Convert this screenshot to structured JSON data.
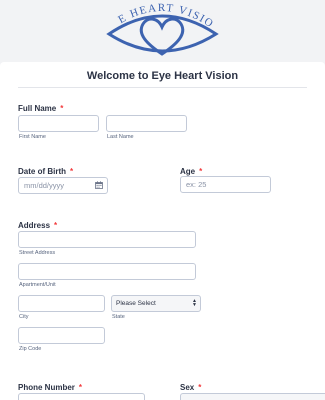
{
  "logo": {
    "text": "EYE HEART VISION",
    "color": "#3d63b0"
  },
  "form": {
    "title": "Welcome to Eye Heart Vision",
    "required_mark": "*",
    "fields": {
      "full_name": {
        "label": "Full Name",
        "first_sublabel": "First Name",
        "last_sublabel": "Last Name",
        "first_value": "",
        "last_value": ""
      },
      "dob": {
        "label": "Date of Birth",
        "placeholder": "mm/dd/yyyy"
      },
      "age": {
        "label": "Age",
        "placeholder": "ex: 25"
      },
      "address": {
        "label": "Address",
        "street_sublabel": "Street Address",
        "apt_sublabel": "Apartment/Unit",
        "city_sublabel": "City",
        "state_sublabel": "State",
        "state_selected": "Please Select",
        "zip_sublabel": "Zip Code"
      },
      "phone": {
        "label": "Phone Number"
      },
      "sex": {
        "label": "Sex"
      }
    }
  },
  "colors": {
    "accent": "#3d63b0",
    "required": "#f23a3c",
    "page_bg": "#f2f3f5"
  }
}
